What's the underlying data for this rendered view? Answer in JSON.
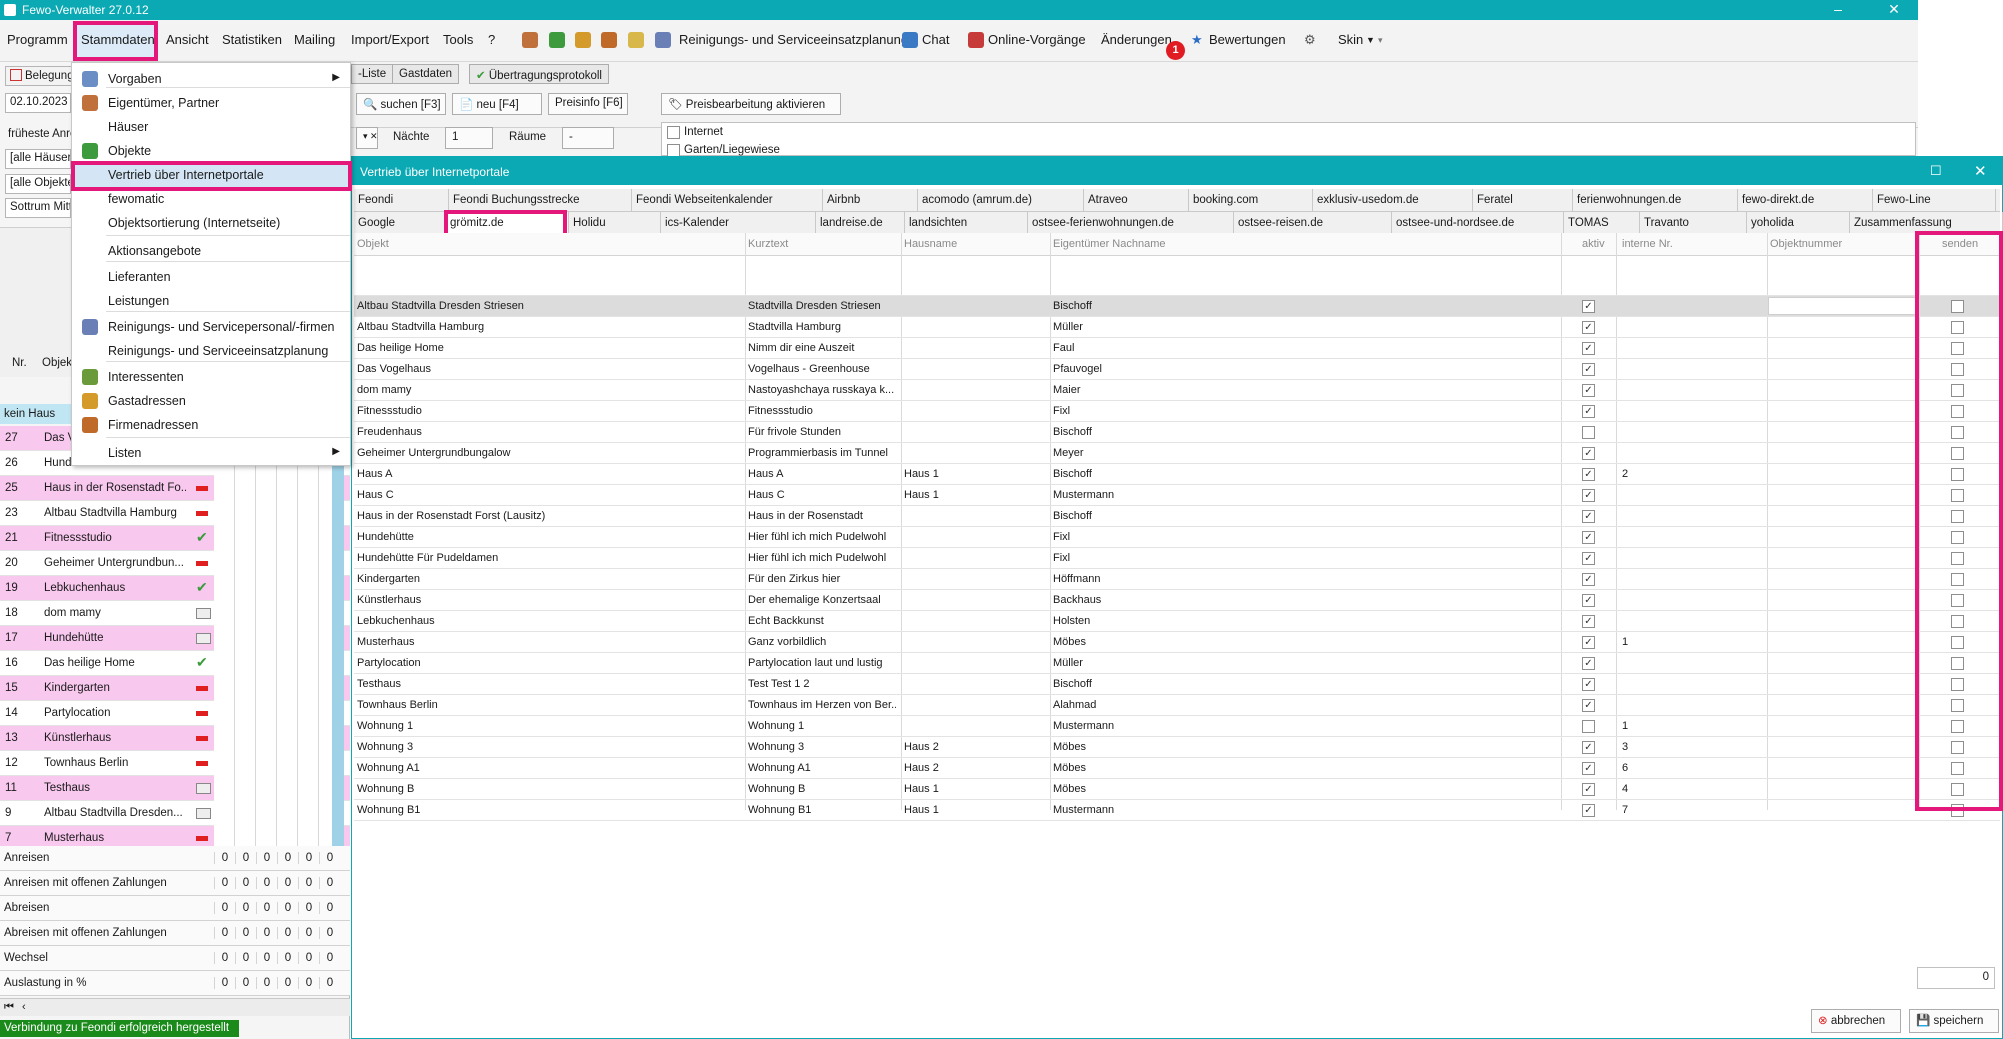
{
  "window": {
    "title": "Fewo-Verwalter 27.0.12",
    "controls": [
      "–",
      "❐",
      "✕"
    ]
  },
  "menubar": {
    "items": [
      "Programm",
      "Stammdaten",
      "Ansicht",
      "Statistiken",
      "Mailing",
      "Import/Export",
      "Tools",
      "?"
    ],
    "tools": [
      "Reinigungs- und Serviceeinsatzplanung",
      "Chat",
      "Online-Vorgänge",
      "Änderungen",
      "Bewertungen",
      "Skin"
    ],
    "badge_count": "1"
  },
  "dropdown": {
    "items": [
      {
        "label": "Vorgaben",
        "submenu": true
      },
      {
        "label": "Eigentümer, Partner"
      },
      {
        "label": "Häuser"
      },
      {
        "label": "Objekte"
      },
      {
        "label": "Vertrieb über Internetportale"
      },
      {
        "label": "fewomatic"
      },
      {
        "label": "Objektsortierung (Internetseite)"
      },
      {
        "label": "Aktionsangebote"
      },
      {
        "label": "Lieferanten"
      },
      {
        "label": "Leistungen"
      },
      {
        "label": "Reinigungs- und Servicepersonal/-firmen"
      },
      {
        "label": "Reinigungs- und Serviceeinsatzplanung"
      },
      {
        "label": "Interessenten"
      },
      {
        "label": "Gastadressen"
      },
      {
        "label": "Firmenadressen"
      },
      {
        "label": "Listen",
        "submenu": true
      }
    ]
  },
  "left": {
    "belegung": "Belegung",
    "date": "02.10.2023",
    "frueheste": "früheste Anre",
    "filter_haeuser": "[alle Häuser]",
    "filter_objekte": "[alle Objekte",
    "ort": "Sottrum Mitte",
    "col_nr": "Nr.",
    "col_objekt": "Objek",
    "kein_haus": "kein Haus",
    "rows": [
      {
        "nr": "27",
        "name": "Das V",
        "status": "",
        "pink": true
      },
      {
        "nr": "26",
        "name": "Hundehütte Für Pudeldam...",
        "status": "check",
        "pink": false
      },
      {
        "nr": "25",
        "name": "Haus in der Rosenstadt Fo...",
        "status": "minus",
        "pink": true
      },
      {
        "nr": "23",
        "name": "Altbau Stadtvilla Hamburg",
        "status": "minus",
        "pink": false
      },
      {
        "nr": "21",
        "name": "Fitnessstudio",
        "status": "check",
        "pink": true
      },
      {
        "nr": "20",
        "name": "Geheimer Untergrundbun...",
        "status": "minus",
        "pink": false
      },
      {
        "nr": "19",
        "name": "Lebkuchenhaus",
        "status": "check",
        "pink": true
      },
      {
        "nr": "18",
        "name": "dom mamy",
        "status": "card",
        "pink": false
      },
      {
        "nr": "17",
        "name": "Hundehütte",
        "status": "card",
        "pink": true
      },
      {
        "nr": "16",
        "name": "Das heilige Home",
        "status": "check",
        "pink": false
      },
      {
        "nr": "15",
        "name": "Kindergarten",
        "status": "minus",
        "pink": true
      },
      {
        "nr": "14",
        "name": "Partylocation",
        "status": "minus",
        "pink": false
      },
      {
        "nr": "13",
        "name": "Künstlerhaus",
        "status": "minus",
        "pink": true
      },
      {
        "nr": "12",
        "name": "Townhaus Berlin",
        "status": "minus",
        "pink": false
      },
      {
        "nr": "11",
        "name": "Testhaus",
        "status": "card",
        "pink": true
      },
      {
        "nr": "9",
        "name": "Altbau Stadtvilla Dresden...",
        "status": "card",
        "pink": false
      },
      {
        "nr": "7",
        "name": "Musterhaus",
        "status": "minus",
        "pink": true
      }
    ],
    "summary": [
      {
        "label": "Anreisen",
        "values": [
          "0",
          "0",
          "0",
          "0",
          "0",
          "0"
        ]
      },
      {
        "label": "Anreisen mit offenen Zahlungen",
        "values": [
          "0",
          "0",
          "0",
          "0",
          "0",
          "0"
        ]
      },
      {
        "label": "Abreisen",
        "values": [
          "0",
          "0",
          "0",
          "0",
          "0",
          "0"
        ]
      },
      {
        "label": "Abreisen mit offenen Zahlungen",
        "values": [
          "0",
          "0",
          "0",
          "0",
          "0",
          "0"
        ]
      },
      {
        "label": "Wechsel",
        "values": [
          "0",
          "0",
          "0",
          "0",
          "0",
          "0"
        ]
      },
      {
        "label": "Auslastung in %",
        "values": [
          "0",
          "0",
          "0",
          "0",
          "0",
          "0"
        ]
      }
    ],
    "status": "Verbindung zu Feondi erfolgreich hergestellt"
  },
  "back_toolbar": {
    "tabs": [
      "-Liste",
      "Gastdaten",
      "Übertragungsprotokoll"
    ],
    "suchen": "suchen [F3]",
    "neu": "neu [F4]",
    "preisinfo": "Preisinfo [F6]",
    "preisbearbeitung": "Preisbearbeitung aktivieren",
    "naechte_label": "Nächte",
    "naechte_value": "1",
    "raeume_label": "Räume",
    "raeume_value": "-",
    "internet": "Internet",
    "garten": "Garten/Liegewiese"
  },
  "dialog": {
    "title": "Vertrieb über Internetportale",
    "tabs_row1": [
      "Feondi",
      "Feondi Buchungsstrecke",
      "Feondi Webseitenkalender",
      "Airbnb",
      "acomodo (amrum.de)",
      "Atraveo",
      "booking.com",
      "exklusiv-usedom.de",
      "Feratel",
      "ferienwohnungen.de",
      "fewo-direkt.de",
      "Fewo-Line"
    ],
    "tabs_row2": [
      "Google",
      "grömitz.de",
      "Holidu",
      "ics-Kalender",
      "landreise.de",
      "landsichten",
      "ostsee-ferienwohnungen.de",
      "ostsee-reisen.de",
      "ostsee-und-nordsee.de",
      "TOMAS",
      "Travanto",
      "yoholida",
      "Zusammenfassung"
    ],
    "columns": [
      "Objekt",
      "Kurztext",
      "Hausname",
      "Eigentümer Nachname",
      "aktiv",
      "interne Nr.",
      "Objektnummer",
      "senden"
    ],
    "rows": [
      {
        "objekt": "Altbau Stadtvilla Dresden Striesen",
        "kurztext": "Stadtvilla Dresden Striesen",
        "haus": "",
        "eigentuemer": "Bischoff",
        "aktiv": true,
        "nr": ""
      },
      {
        "objekt": "Altbau Stadtvilla Hamburg",
        "kurztext": "Stadtvilla Hamburg",
        "haus": "",
        "eigentuemer": "Müller",
        "aktiv": true,
        "nr": ""
      },
      {
        "objekt": "Das heilige Home",
        "kurztext": "Nimm dir eine Auszeit",
        "haus": "",
        "eigentuemer": "Faul",
        "aktiv": true,
        "nr": ""
      },
      {
        "objekt": "Das Vogelhaus",
        "kurztext": "Vogelhaus - Greenhouse",
        "haus": "",
        "eigentuemer": "Pfauvogel",
        "aktiv": true,
        "nr": ""
      },
      {
        "objekt": "dom mamy",
        "kurztext": "Nastoyashchaya russkaya k...",
        "haus": "",
        "eigentuemer": "Maier",
        "aktiv": true,
        "nr": ""
      },
      {
        "objekt": "Fitnessstudio",
        "kurztext": "Fitnessstudio",
        "haus": "",
        "eigentuemer": "Fixl",
        "aktiv": true,
        "nr": ""
      },
      {
        "objekt": "Freudenhaus",
        "kurztext": "Für frivole Stunden",
        "haus": "",
        "eigentuemer": "Bischoff",
        "aktiv": false,
        "nr": ""
      },
      {
        "objekt": "Geheimer Untergrundbungalow",
        "kurztext": "Programmierbasis im Tunnel",
        "haus": "",
        "eigentuemer": "Meyer",
        "aktiv": true,
        "nr": ""
      },
      {
        "objekt": "Haus A",
        "kurztext": "Haus A",
        "haus": "Haus 1",
        "eigentuemer": "Bischoff",
        "aktiv": true,
        "nr": "2"
      },
      {
        "objekt": "Haus C",
        "kurztext": "Haus C",
        "haus": "Haus 1",
        "eigentuemer": "Mustermann",
        "aktiv": true,
        "nr": ""
      },
      {
        "objekt": "Haus in der Rosenstadt Forst (Lausitz)",
        "kurztext": "Haus in der Rosenstadt",
        "haus": "",
        "eigentuemer": "Bischoff",
        "aktiv": true,
        "nr": ""
      },
      {
        "objekt": "Hundehütte",
        "kurztext": "Hier fühl ich mich Pudelwohl",
        "haus": "",
        "eigentuemer": "Fixl",
        "aktiv": true,
        "nr": ""
      },
      {
        "objekt": "Hundehütte Für Pudeldamen",
        "kurztext": "Hier fühl ich mich Pudelwohl",
        "haus": "",
        "eigentuemer": "Fixl",
        "aktiv": true,
        "nr": ""
      },
      {
        "objekt": "Kindergarten",
        "kurztext": "Für den Zirkus hier",
        "haus": "",
        "eigentuemer": "Höffmann",
        "aktiv": true,
        "nr": ""
      },
      {
        "objekt": "Künstlerhaus",
        "kurztext": "Der ehemalige Konzertsaal",
        "haus": "",
        "eigentuemer": "Backhaus",
        "aktiv": true,
        "nr": ""
      },
      {
        "objekt": "Lebkuchenhaus",
        "kurztext": "Echt Backkunst",
        "haus": "",
        "eigentuemer": "Holsten",
        "aktiv": true,
        "nr": ""
      },
      {
        "objekt": "Musterhaus",
        "kurztext": "Ganz vorbildlich",
        "haus": "",
        "eigentuemer": "Möbes",
        "aktiv": true,
        "nr": "1"
      },
      {
        "objekt": "Partylocation",
        "kurztext": "Partylocation laut und lustig",
        "haus": "",
        "eigentuemer": "Müller",
        "aktiv": true,
        "nr": ""
      },
      {
        "objekt": "Testhaus",
        "kurztext": "Test Test 1 2",
        "haus": "",
        "eigentuemer": "Bischoff",
        "aktiv": true,
        "nr": ""
      },
      {
        "objekt": "Townhaus Berlin",
        "kurztext": "Townhaus im Herzen von Ber...",
        "haus": "",
        "eigentuemer": "Alahmad",
        "aktiv": true,
        "nr": ""
      },
      {
        "objekt": "Wohnung 1",
        "kurztext": "Wohnung 1",
        "haus": "",
        "eigentuemer": "Mustermann",
        "aktiv": false,
        "nr": "1"
      },
      {
        "objekt": "Wohnung 3",
        "kurztext": "Wohnung 3",
        "haus": "Haus 2",
        "eigentuemer": "Möbes",
        "aktiv": true,
        "nr": "3"
      },
      {
        "objekt": "Wohnung A1",
        "kurztext": "Wohnung A1",
        "haus": "Haus 2",
        "eigentuemer": "Möbes",
        "aktiv": true,
        "nr": "6"
      },
      {
        "objekt": "Wohnung B",
        "kurztext": "Wohnung B",
        "haus": "Haus 1",
        "eigentuemer": "Möbes",
        "aktiv": true,
        "nr": "4"
      },
      {
        "objekt": "Wohnung B1",
        "kurztext": "Wohnung B1",
        "haus": "Haus 1",
        "eigentuemer": "Mustermann",
        "aktiv": true,
        "nr": "7"
      }
    ],
    "count": "0",
    "abbrechen": "abbrechen",
    "speichern": "speichern"
  }
}
